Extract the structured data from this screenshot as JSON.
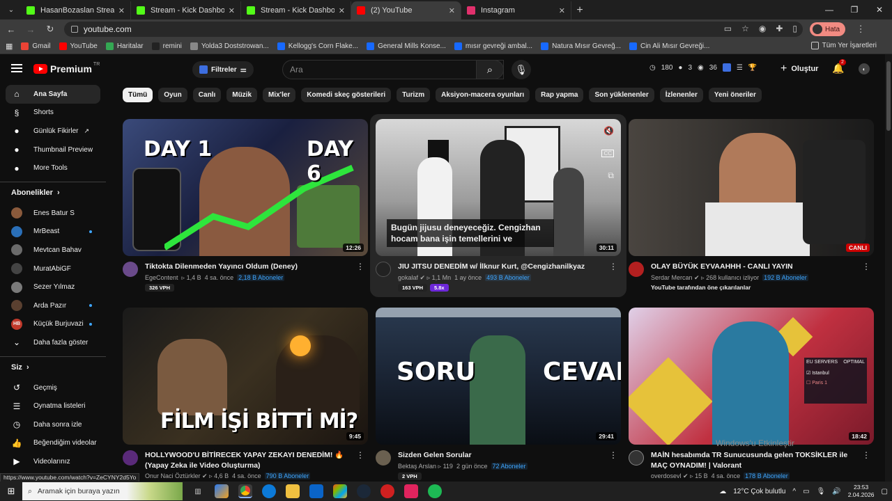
{
  "browser": {
    "tabs": [
      {
        "title": "HasanBozaslan Stream - Watch",
        "icon": "kick-icon",
        "color": "#53fc18",
        "active": false
      },
      {
        "title": "Stream - Kick Dashboard",
        "icon": "kick-icon",
        "color": "#53fc18",
        "active": false
      },
      {
        "title": "Stream - Kick Dashboard",
        "icon": "kick-icon",
        "color": "#53fc18",
        "active": false
      },
      {
        "title": "(2) YouTube",
        "icon": "youtube-icon",
        "color": "#ff0000",
        "active": true
      },
      {
        "title": "Instagram",
        "icon": "instagram-icon",
        "color": "#e1306c",
        "active": false
      }
    ],
    "url": "youtube.com",
    "profile_label": "Hata",
    "bookmarks": [
      {
        "label": "Gmail",
        "icon": "gmail-icon",
        "color": "#ea4335"
      },
      {
        "label": "YouTube",
        "icon": "youtube-icon",
        "color": "#ff0000"
      },
      {
        "label": "Haritalar",
        "icon": "maps-icon",
        "color": "#34a853"
      },
      {
        "label": "remini",
        "icon": "remini-icon",
        "color": "#222222"
      },
      {
        "label": "Yolda3 Doststrowan...",
        "icon": "link-icon",
        "color": "#888888"
      },
      {
        "label": "Kellogg's Corn Flake...",
        "icon": "behance-icon",
        "color": "#1769ff"
      },
      {
        "label": "General Mills Konse...",
        "icon": "behance-icon",
        "color": "#1769ff"
      },
      {
        "label": "mısır gevreği ambal...",
        "icon": "behance-icon",
        "color": "#1769ff"
      },
      {
        "label": "Natura Mısır Gevreğ...",
        "icon": "behance-icon",
        "color": "#1769ff"
      },
      {
        "label": "Cin Ali Mısır Gevreği...",
        "icon": "behance-icon",
        "color": "#1769ff"
      }
    ],
    "all_bookmarks": "Tüm Yer İşaretleri",
    "status_url": "https://www.youtube.com/watch?v=ZeCYNY2d5Yo"
  },
  "youtube": {
    "logo": "Premium",
    "region": "TR",
    "filters_label": "Filtreler",
    "search_placeholder": "Ara",
    "stats": {
      "views": "180",
      "count2": "3",
      "count3": "36"
    },
    "create_label": "Oluştur",
    "notif_count": "2",
    "sidebar": {
      "main": [
        {
          "label": "Ana Sayfa",
          "icon": "home-icon"
        },
        {
          "label": "Shorts",
          "icon": "shorts-icon"
        },
        {
          "label": "Günlük Fikirler",
          "icon": "ideas-icon"
        },
        {
          "label": "Thumbnail Preview",
          "icon": "thumbnail-icon"
        },
        {
          "label": "More Tools",
          "icon": "tools-icon"
        }
      ],
      "subs_heading": "Abonelikler",
      "subs": [
        {
          "label": "Enes Batur S",
          "color": "#8a5a3c",
          "initials": "",
          "dot": false
        },
        {
          "label": "MrBeast",
          "color": "#2a6fb8",
          "initials": "",
          "dot": true
        },
        {
          "label": "Mevtcan Bahav",
          "color": "#6b6b6b",
          "initials": "",
          "dot": false
        },
        {
          "label": "MuratAbiGF",
          "color": "#444444",
          "initials": "",
          "dot": false
        },
        {
          "label": "Sezer Yılmaz",
          "color": "#7a7a7a",
          "initials": "",
          "dot": false
        },
        {
          "label": "Arda Pazır",
          "color": "#5a4030",
          "initials": "",
          "dot": true
        },
        {
          "label": "Küçük Burjuvazi",
          "color": "#c0392b",
          "initials": "HB",
          "dot": true
        }
      ],
      "show_more": "Daha fazla göster",
      "you_heading": "Siz",
      "you": [
        {
          "label": "Geçmiş",
          "icon": "history-icon"
        },
        {
          "label": "Oynatma listeleri",
          "icon": "playlist-icon"
        },
        {
          "label": "Daha sonra izle",
          "icon": "clock-icon"
        },
        {
          "label": "Beğendiğim videolar",
          "icon": "like-icon"
        },
        {
          "label": "Videolarınız",
          "icon": "video-icon"
        }
      ]
    },
    "chips": [
      "Tümü",
      "Oyun",
      "Canlı",
      "Müzik",
      "Mix'ler",
      "Komedi skeç gösterileri",
      "Turizm",
      "Aksiyon-macera oyunları",
      "Rap yapma",
      "Son yüklenenler",
      "İzlenenler",
      "Yeni öneriler"
    ],
    "videos": [
      {
        "title": "Tiktokta Dilenmeden Yayıncı Oldum (Deney)",
        "channel": "EgeContent",
        "views": "1,4 B",
        "age": "4 sa. önce",
        "subs": "2,18 B Aboneler",
        "duration": "12:26",
        "vph": "326 VPH",
        "thumb_text_1": "DAY 1",
        "thumb_text_2": "DAY 6"
      },
      {
        "title": "JIU JITSU DENEDİM w/ İlknur Kurt, @Cengizhanilkyaz",
        "channel": "gokalaf",
        "views": "1,1 Mn",
        "age": "1 ay önce",
        "subs": "493 B Aboneler",
        "duration": "30:11",
        "vph": "163 VPH",
        "extra": "5.8x",
        "caption": "Bugün jijusu deneyeceğiz. Cengizhan hocam bana işin temellerini ve"
      },
      {
        "title": "OLAY BÜYÜK EYVAAHHH - CANLI YAYIN",
        "channel": "Serdar Mercan",
        "views": "268 kullanıcı izliyor",
        "age": "",
        "subs": "192 B Aboneler",
        "duration": "CANLI",
        "note": "YouTube tarafından öne çıkarılanlar"
      },
      {
        "title": "HOLLYWOOD'U BİTİRECEK YAPAY ZEKAYI DENEDİM! 🔥 (Yapay Zeka ile Video Oluşturma)",
        "channel": "Onur Naci Öztürkler",
        "views": "4,6 B",
        "age": "4 sa. önce",
        "subs": "790 B Aboneler",
        "duration": "9:45",
        "thumb_text_1": "FİLM İŞİ BİTTİ Mİ?"
      },
      {
        "title": "Sizden Gelen Sorular",
        "channel": "Bektaş Arslan",
        "views": "119",
        "age": "2 gün önce",
        "subs": "72 Aboneler",
        "duration": "29:41",
        "vph": "2 VPH",
        "thumb_text_1": "SORU",
        "thumb_text_2": "CEVAP"
      },
      {
        "title": "MAİN hesabımda TR Sunucusunda gelen TOKSİKLER ile MAÇ OYNADIM! | Valorant",
        "channel": "overdosevl",
        "views": "15 B",
        "age": "4 sa. önce",
        "subs": "178 B Aboneler",
        "duration": "18:42",
        "thumb_text_1": "EU SERVERS",
        "thumb_text_2": "OPTIMAL",
        "thumb_text_3": "Istanbul",
        "thumb_text_4": "Paris 1"
      }
    ],
    "watermark": "Windows'u Etkinleştir"
  },
  "taskbar": {
    "search_placeholder": "Aramak için buraya yazın",
    "weather": "12°C  Çok bulutlu",
    "time": "23:53",
    "date": "2.04.2026"
  }
}
